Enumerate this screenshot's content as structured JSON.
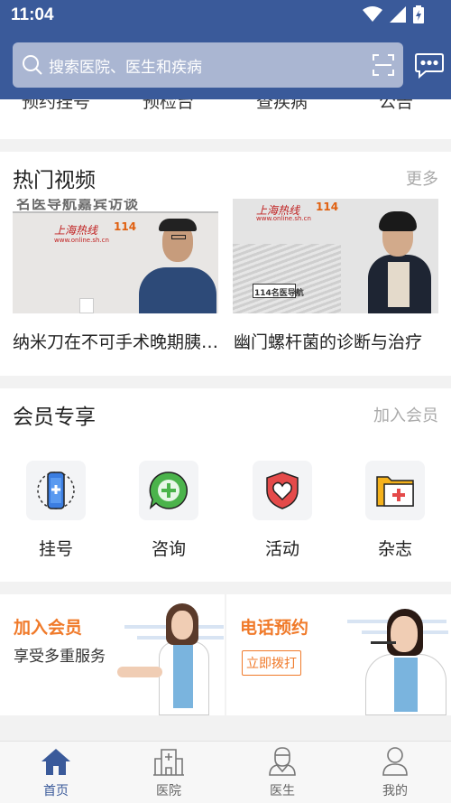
{
  "status_bar": {
    "time": "11:04"
  },
  "search": {
    "placeholder": "搜索医院、医生和疾病"
  },
  "quick_links": [
    "预约挂号",
    "预检台",
    "查疾病",
    "公告"
  ],
  "videos": {
    "title": "热门视频",
    "more": "更多",
    "items": [
      {
        "caption": "纳米刀在不可手术晚期胰腺癌中的应用",
        "banner": "名医导航嘉宾访谈",
        "logo": "上海热线",
        "site": "www.online.sh.cn",
        "badge": "114"
      },
      {
        "caption": "幽门螺杆菌的诊断与治疗",
        "logo": "上海热线",
        "site": "www.online.sh.cn",
        "badge": "114",
        "sign": "114名医导航"
      }
    ]
  },
  "member": {
    "title": "会员专享",
    "join": "加入会员",
    "items": [
      {
        "label": "挂号",
        "icon": "phone-plus-icon"
      },
      {
        "label": "咨询",
        "icon": "chat-plus-icon"
      },
      {
        "label": "活动",
        "icon": "heart-shield-icon"
      },
      {
        "label": "杂志",
        "icon": "folder-cross-icon"
      }
    ]
  },
  "promo": {
    "join_title": "加入会员",
    "join_sub": "享受多重服务",
    "call_title": "电话预约",
    "call_button": "立即拨打"
  },
  "tabs": [
    {
      "label": "首页",
      "active": true
    },
    {
      "label": "医院",
      "active": false
    },
    {
      "label": "医生",
      "active": false
    },
    {
      "label": "我的",
      "active": false
    }
  ],
  "colors": {
    "primary": "#3a5a9a",
    "accent": "#f07a2a",
    "tab_active": "#3a5a9a"
  }
}
